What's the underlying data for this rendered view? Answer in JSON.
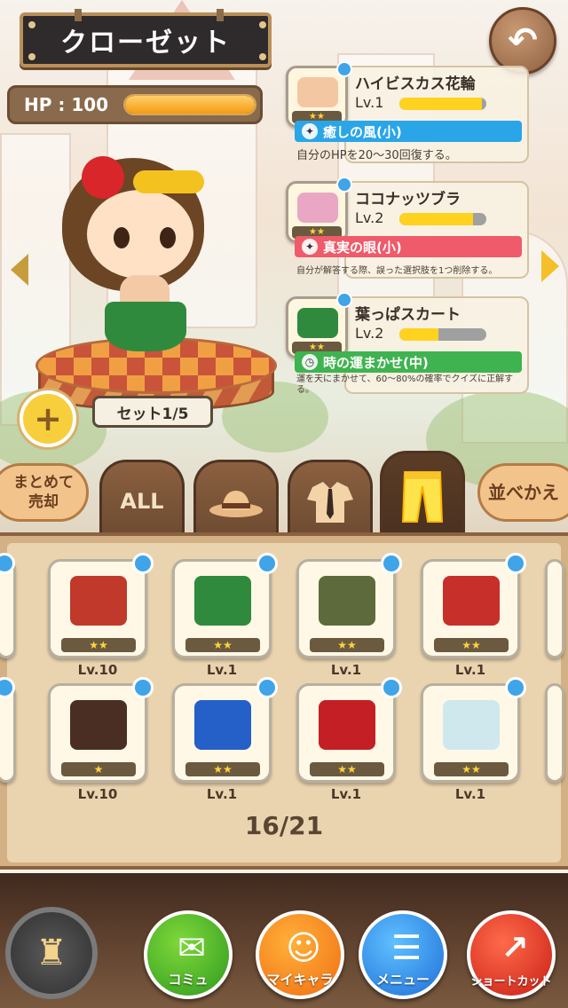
{
  "header": {
    "title": "クローゼット",
    "back_icon": "back-arrow-icon"
  },
  "status": {
    "hp_label": "HP : 100",
    "hp_fraction": 1.0
  },
  "character": {
    "set_label": "セット1/5",
    "add_icon": "plus-icon"
  },
  "equipped": [
    {
      "name": "ハイビスカス花輪",
      "level": "Lv.1",
      "level_fraction": 0.95,
      "stars": "★★",
      "skill": "癒しの風(小)",
      "skill_color": "#2aa6e8",
      "description": "自分のHPを20〜30回復する。"
    },
    {
      "name": "ココナッツブラ",
      "level": "Lv.2",
      "level_fraction": 0.85,
      "stars": "★★",
      "skill": "真実の眼(小)",
      "skill_color": "#ef5b6a",
      "description": "自分が解答する際、誤った選択肢を1つ削除する。"
    },
    {
      "name": "葉っぱスカート",
      "level": "Lv.2",
      "level_fraction": 0.45,
      "stars": "★★",
      "skill": "時の運まかせ(中)",
      "skill_color": "#3fb34f",
      "description": "運を天にまかせて、60〜80%の確率でクイズに正解する。"
    }
  ],
  "tabs": {
    "sell_label": "まとめて売却",
    "all_label": "ALL",
    "sort_label": "並べかえ",
    "hat_icon": "hat-icon",
    "shirt_icon": "shirt-icon",
    "pants_icon": "pants-icon"
  },
  "inventory": {
    "row1": [
      {
        "level": "Lv.10",
        "stars": "★★",
        "color": "#c0392b"
      },
      {
        "level": "Lv.1",
        "stars": "★★",
        "color": "#2f8a3d"
      },
      {
        "level": "Lv.1",
        "stars": "★★",
        "color": "#5d6b3c"
      },
      {
        "level": "Lv.1",
        "stars": "★★",
        "color": "#c7302a"
      }
    ],
    "row2": [
      {
        "level": "Lv.10",
        "stars": "★",
        "color": "#4a2e24"
      },
      {
        "level": "Lv.1",
        "stars": "★★",
        "color": "#2560c8"
      },
      {
        "level": "Lv.1",
        "stars": "★★",
        "color": "#c41f25"
      },
      {
        "level": "Lv.1",
        "stars": "★★",
        "color": "#cfe8ee"
      }
    ],
    "count": "16/21"
  },
  "nav": {
    "community": "コミュ",
    "my_character": "マイキャラ",
    "menu": "メニュー",
    "shortcut": "ショートカット"
  }
}
